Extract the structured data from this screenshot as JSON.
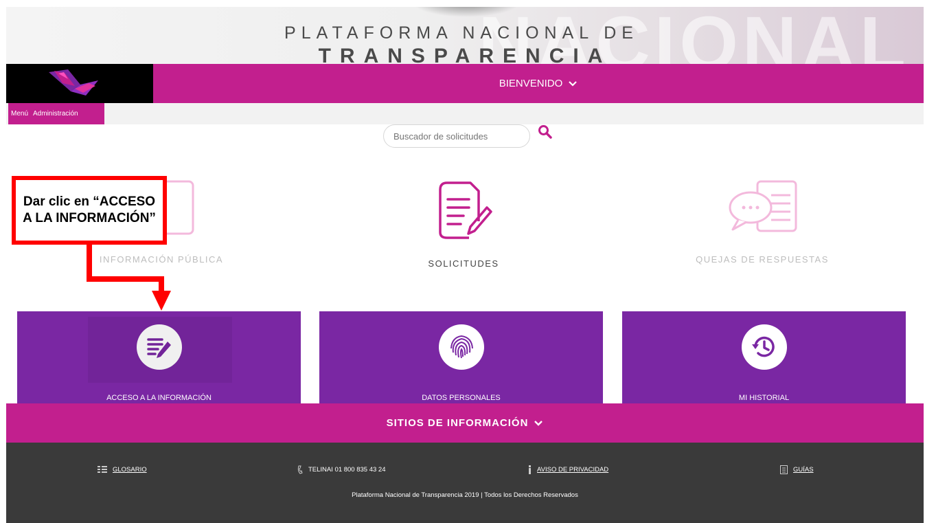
{
  "header": {
    "title_top": "PLATAFORMA NACIONAL DE",
    "title_main": "TRANSPARENCIA",
    "ghost_text": "NACIONAL"
  },
  "nav": {
    "welcome": "BIENVENIDO",
    "menu_items": [
      "Menú",
      "Administración"
    ]
  },
  "search": {
    "placeholder": "Buscador de solicitudes",
    "icon": "search-icon"
  },
  "categories": [
    {
      "label": "INFORMACIÓN PÚBLICA",
      "icon": "document-icon",
      "faded": true
    },
    {
      "label": "SOLICITUDES",
      "icon": "document-pencil-icon",
      "faded": false
    },
    {
      "label": "QUEJAS DE RESPUESTAS",
      "icon": "speech-bubble-icon",
      "faded": true
    }
  ],
  "cards": [
    {
      "label": "ACCESO A LA INFORMACIÓN",
      "icon": "document-pencil-icon"
    },
    {
      "label": "DATOS PERSONALES",
      "icon": "fingerprint-icon"
    },
    {
      "label": "MI HISTORIAL",
      "icon": "history-clock-icon"
    }
  ],
  "sites": {
    "label": "SITIOS DE INFORMACIÓN"
  },
  "footer": {
    "links": [
      {
        "label": "GLOSARIO",
        "icon": "glossary-icon",
        "underline": true
      },
      {
        "label": "TELINAI 01 800 835 43 24",
        "icon": "phone-icon",
        "underline": false
      },
      {
        "label": "AVISO DE PRIVACIDAD",
        "icon": "info-icon",
        "underline": true
      },
      {
        "label": "GUÍAS",
        "icon": "guide-icon",
        "underline": true
      }
    ],
    "copyright": "Plataforma Nacional de Transparencia 2019 | Todos los Derechos Reservados"
  },
  "annotation": {
    "text": "Dar clic en “ACCESO A LA INFORMACIÓN”"
  },
  "colors": {
    "magenta": "#c21f8e",
    "purple": "#7a27a3",
    "footer": "#3a3a3a",
    "annotation_red": "#ff0000"
  }
}
